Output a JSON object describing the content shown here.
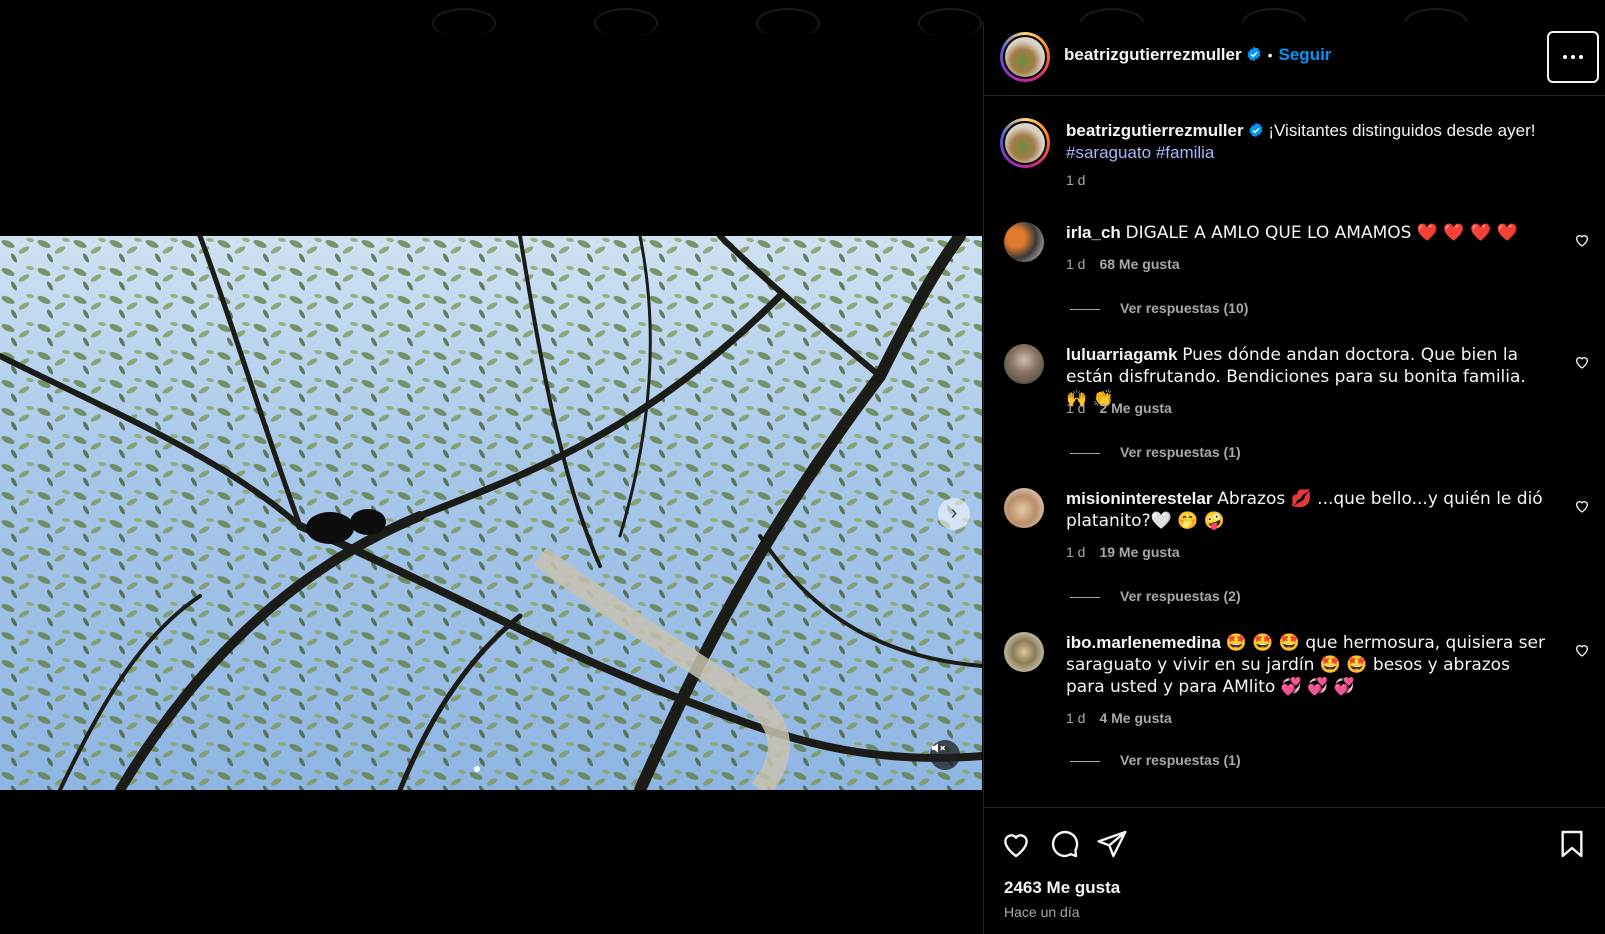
{
  "post": {
    "author": "beatrizgutierrezmuller",
    "follow_label": "Seguir",
    "dot": "•",
    "caption": "¡Visitantes distinguidos desde ayer!",
    "hashtags": [
      "#saraguato",
      "#familia"
    ],
    "caption_time": "1 d",
    "likes_label": "2463 Me gusta",
    "time_label": "Hace un día"
  },
  "comments": [
    {
      "user": "irla_ch",
      "text": "DIGALE A AMLO QUE LO AMAMOS ❤️ ❤️ ❤️ ❤️",
      "time": "1 d",
      "likes": "68 Me gusta",
      "replies": "Ver respuestas (10)"
    },
    {
      "user": "luluarriagamk",
      "text": "Pues dónde andan doctora. Que bien la están disfrutando. Bendiciones para su bonita familia. 🙌 👏",
      "time": "1 d",
      "likes": "2 Me gusta",
      "replies": "Ver respuestas (1)"
    },
    {
      "user": "misioninterestelar",
      "text": "Abrazos 💋 ...que bello...y quién le dió platanito?🤍 🤭 🤪",
      "time": "1 d",
      "likes": "19 Me gusta",
      "replies": "Ver respuestas (2)"
    },
    {
      "user": "ibo.marlenemedina",
      "text": "🤩 🤩 🤩  que hermosura, quisiera ser saraguato y vivir en su jardín 🤩 🤩  besos y abrazos para usted y para AMlito 💞 💞 💞",
      "time": "1 d",
      "likes": "4 Me gusta",
      "replies": "Ver respuestas (1)"
    }
  ],
  "icons": {
    "like": "heart-icon",
    "comment": "comment-icon",
    "share": "send-icon",
    "save": "bookmark-icon",
    "more": "more-options-icon",
    "mute": "muted-speaker-icon",
    "next": "chevron-right-icon",
    "verified": "verified-badge-icon"
  },
  "colors": {
    "accent": "#0095f6",
    "hashtag": "#a9b7f8",
    "like_heart": "#ed4956",
    "muted_text": "#a8a8a8"
  }
}
